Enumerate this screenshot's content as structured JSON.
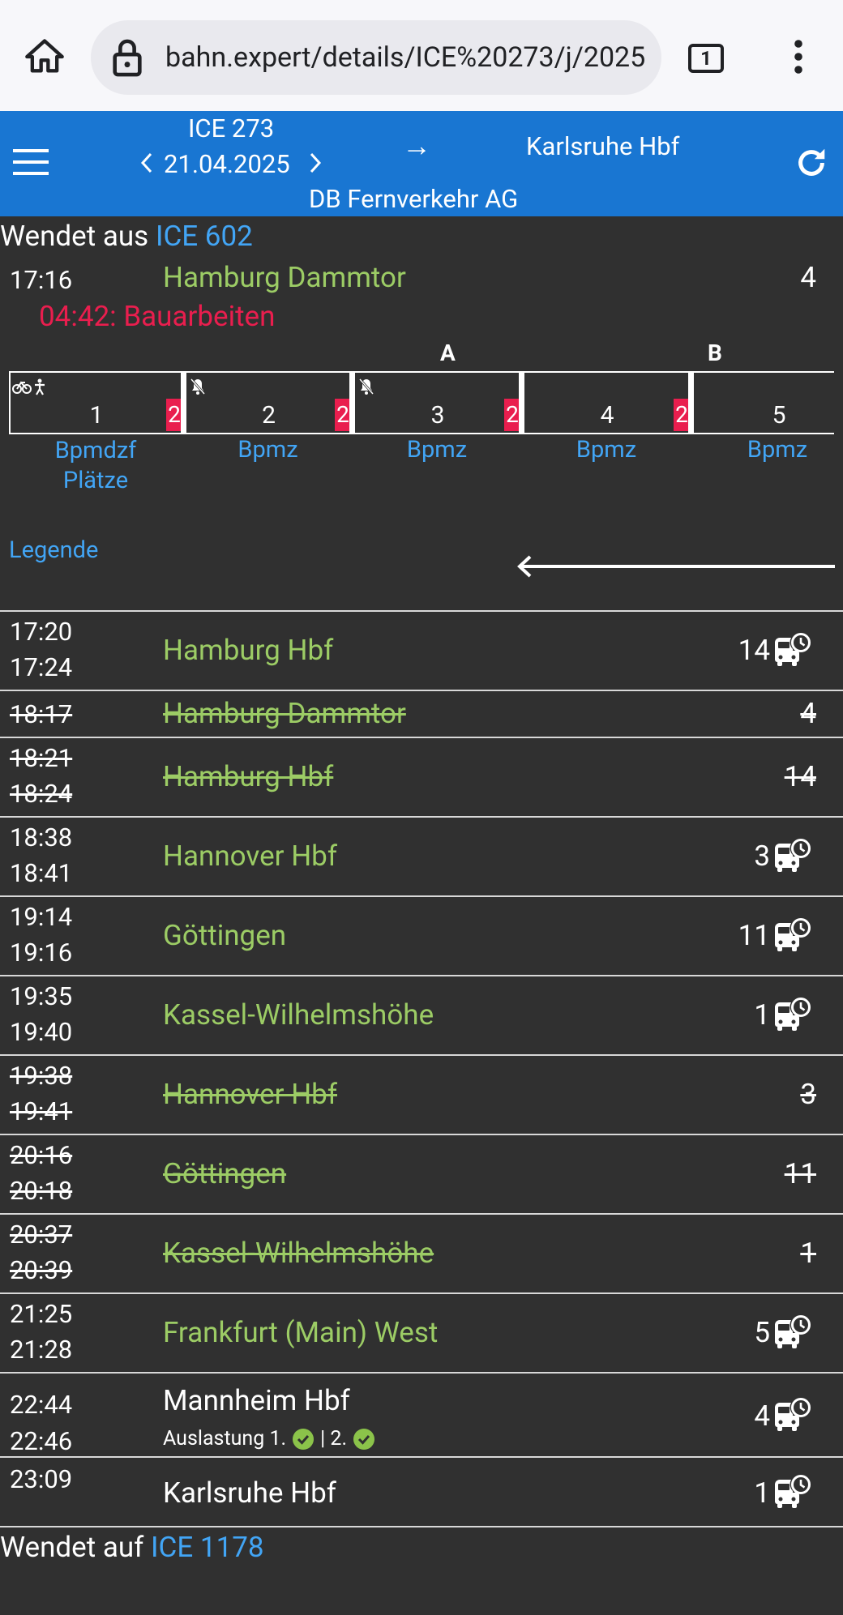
{
  "browser": {
    "url": "bahn.expert/details/ICE%20273/j/2025",
    "tab_count": "1"
  },
  "header": {
    "train": "ICE 273",
    "date": "21.04.2025",
    "arrow": "→",
    "destination": "Karlsruhe Hbf",
    "operator": "DB Fernverkehr AG"
  },
  "turn_from": {
    "label": "Wendet aus",
    "train": "ICE 602"
  },
  "origin": {
    "time": "17:16",
    "station": "Hamburg Dammtor",
    "track": "4",
    "message": "04:42: Bauarbeiten"
  },
  "sectors": [
    "A",
    "B"
  ],
  "wagons": [
    {
      "number": "1",
      "class": "2",
      "type": "Bpmdzf",
      "extra": "Plätze",
      "icons": "bike-wheelchair"
    },
    {
      "number": "2",
      "class": "2",
      "type": "Bpmz",
      "icons": "quiet"
    },
    {
      "number": "3",
      "class": "2",
      "type": "Bpmz",
      "icons": "quiet"
    },
    {
      "number": "4",
      "class": "2",
      "type": "Bpmz",
      "icons": ""
    },
    {
      "number": "5",
      "class": "",
      "type": "Bpmz",
      "icons": ""
    }
  ],
  "legend_label": "Legende",
  "stops": [
    {
      "arr": "17:20",
      "dep": "17:24",
      "station": "Hamburg Hbf",
      "track": "14",
      "cancelled": false,
      "bus": true
    },
    {
      "arr": "18:17",
      "dep": "",
      "station": "Hamburg Dammtor",
      "track": "4",
      "cancelled": true,
      "bus": false
    },
    {
      "arr": "18:21",
      "dep": "18:24",
      "station": "Hamburg Hbf",
      "track": "14",
      "cancelled": true,
      "bus": false
    },
    {
      "arr": "18:38",
      "dep": "18:41",
      "station": "Hannover Hbf",
      "track": "3",
      "cancelled": false,
      "bus": true
    },
    {
      "arr": "19:14",
      "dep": "19:16",
      "station": "Göttingen",
      "track": "11",
      "cancelled": false,
      "bus": true
    },
    {
      "arr": "19:35",
      "dep": "19:40",
      "station": "Kassel-Wilhelmshöhe",
      "track": "1",
      "cancelled": false,
      "bus": true
    },
    {
      "arr": "19:38",
      "dep": "19:41",
      "station": "Hannover Hbf",
      "track": "3",
      "cancelled": true,
      "bus": false
    },
    {
      "arr": "20:16",
      "dep": "20:18",
      "station": "Göttingen",
      "track": "11",
      "cancelled": true,
      "bus": false
    },
    {
      "arr": "20:37",
      "dep": "20:39",
      "station": "Kassel-Wilhelmshöhe",
      "track": "1",
      "cancelled": true,
      "bus": false
    },
    {
      "arr": "21:25",
      "dep": "21:28",
      "station": "Frankfurt (Main) West",
      "track": "5",
      "cancelled": false,
      "bus": true
    }
  ],
  "mannheim": {
    "arr": "22:44",
    "dep": "22:46",
    "station": "Mannheim Hbf",
    "track": "4",
    "load_label": "Auslastung 1.",
    "load_sep": "| 2."
  },
  "final": {
    "arr": "23:09",
    "station": "Karlsruhe Hbf",
    "track": "1"
  },
  "turn_to": {
    "label": "Wendet auf",
    "train": "ICE 1178"
  },
  "colors": {
    "appbar": "#1976d2",
    "station_green": "#9ccc65",
    "link_blue": "#42a5f5",
    "alert_red": "#e91e4e",
    "background": "#303030"
  }
}
